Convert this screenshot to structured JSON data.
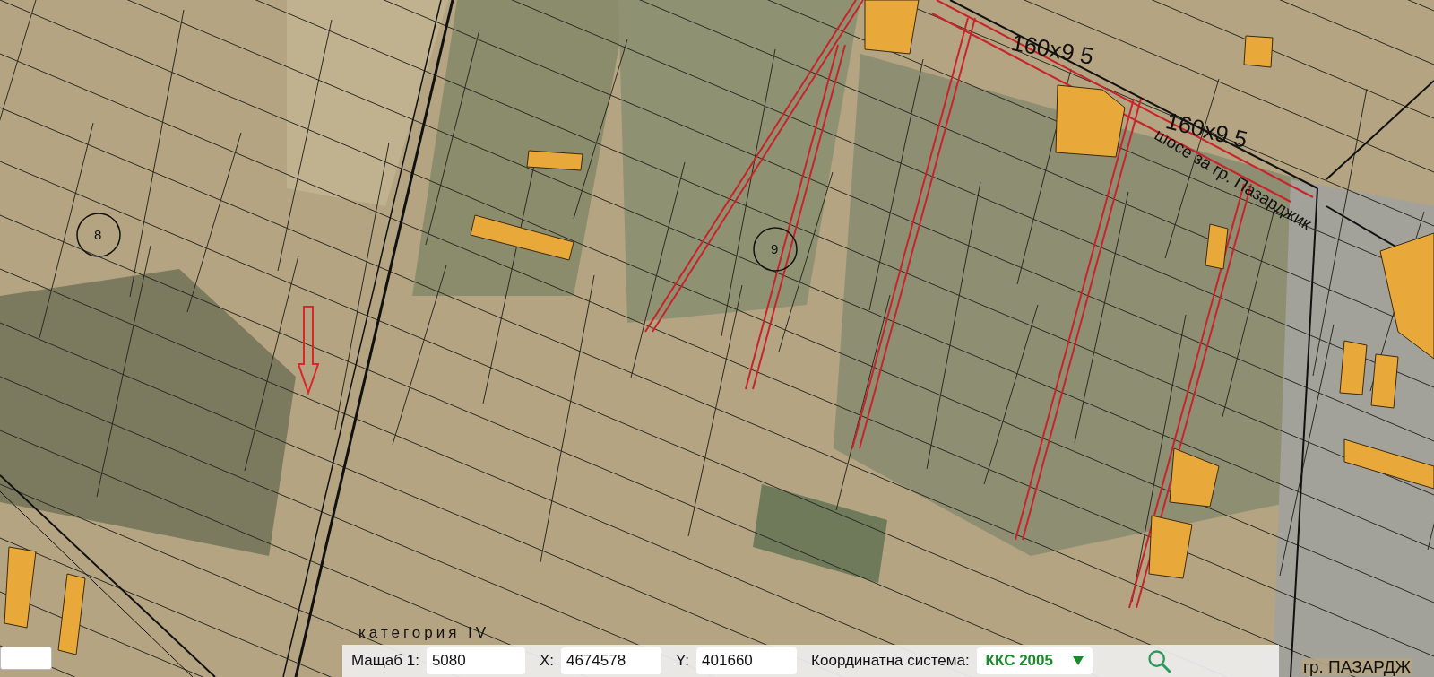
{
  "map": {
    "parcel_labels": [
      "8",
      "9"
    ],
    "dimension_labels": [
      "160x9 5",
      "160x9 5"
    ],
    "road_label": "шосе за гр. Пазарджик",
    "category_label": "категория IV",
    "town_label": "гр. ПАЗАРДЖ"
  },
  "toolbar": {
    "scale": {
      "label": "Мащаб 1:",
      "value": "5080"
    },
    "x": {
      "label": "X:",
      "value": "4674578"
    },
    "y": {
      "label": "Y:",
      "value": "401660"
    },
    "coordinate_system": {
      "label": "Координатна система:",
      "value": "ККС 2005"
    }
  }
}
